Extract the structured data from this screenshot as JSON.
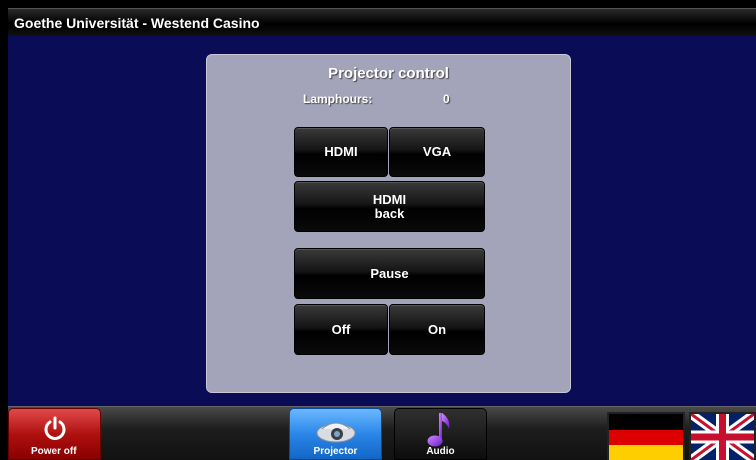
{
  "window": {
    "title": "Goethe Universität - Westend Casino"
  },
  "panel": {
    "title": "Projector control",
    "lamphours_label": "Lamphours:",
    "lamphours_value": "0"
  },
  "buttons": {
    "hdmi": "HDMI",
    "vga": "VGA",
    "hdmi_back_line1": "HDMI",
    "hdmi_back_line2": "back",
    "pause": "Pause",
    "off": "Off",
    "on": "On"
  },
  "bottom_nav": {
    "power_label": "Power off",
    "projector_label": "Projector",
    "audio_label": "Audio",
    "active_tab": "Projector"
  },
  "languages": [
    "German",
    "English"
  ],
  "colors": {
    "background": "#0a0d55",
    "panel": "#a3a3ba",
    "power": "#c01818",
    "active_tab": "#2a86e8"
  }
}
